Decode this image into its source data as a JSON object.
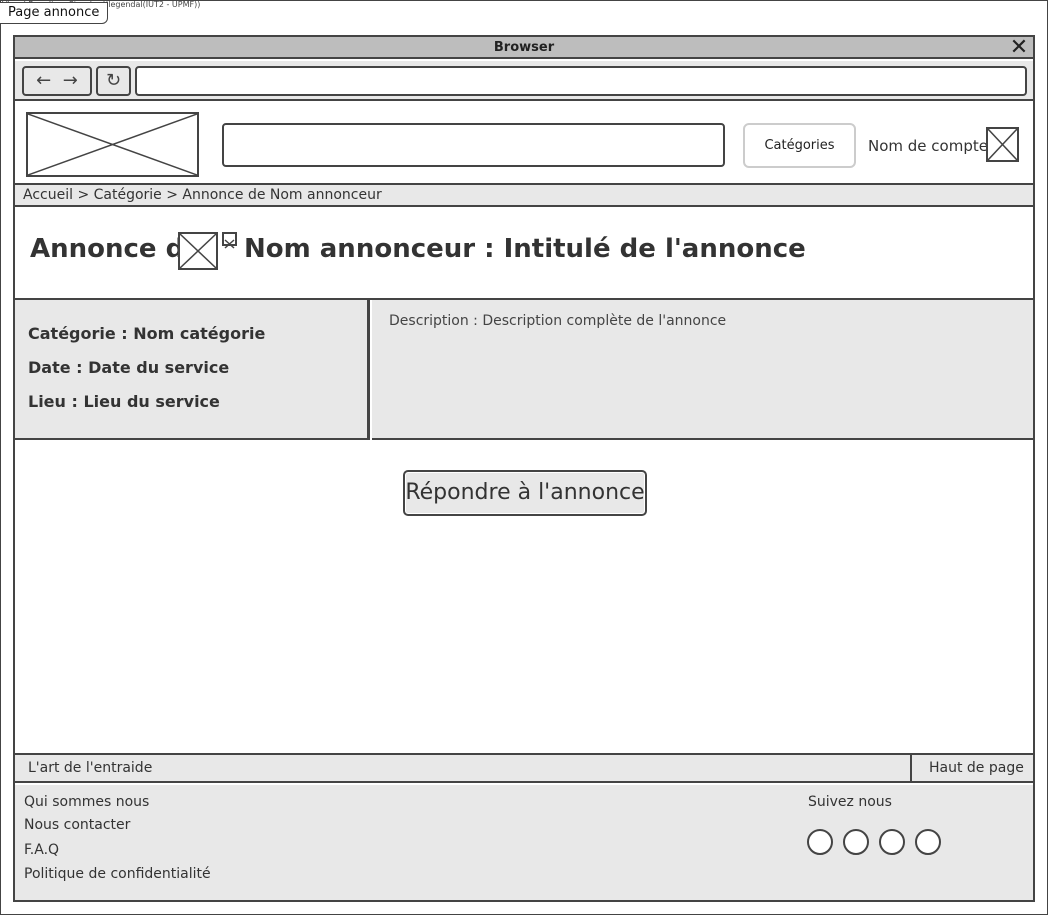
{
  "watermark": "Visual Paradigm Standard(legendal(IUT2 - UPMF))",
  "page_tab": "Page annonce",
  "browser": {
    "title": "Browser",
    "url": ""
  },
  "header": {
    "search_value": "",
    "categories_label": "Catégories",
    "account_name": "Nom de compte"
  },
  "breadcrumb": "Accueil > Catégorie > Annonce de Nom annonceur",
  "ad": {
    "prefix": "Annonce de",
    "title_rest": "Nom annonceur : Intitulé de l'annonce",
    "category_line": "Catégorie : Nom catégorie",
    "date_line": "Date : Date du service",
    "place_line": "Lieu : Lieu du service",
    "description": "Description : Description complète de l'annonce",
    "respond_label": "Répondre à l'annonce"
  },
  "footer": {
    "tagline": "L'art de l'entraide",
    "top_link": "Haut de page",
    "links": [
      "Qui sommes nous",
      "Nous contacter",
      "F.A.Q",
      "Politique de confidentialité"
    ],
    "follow_label": "Suivez nous"
  }
}
